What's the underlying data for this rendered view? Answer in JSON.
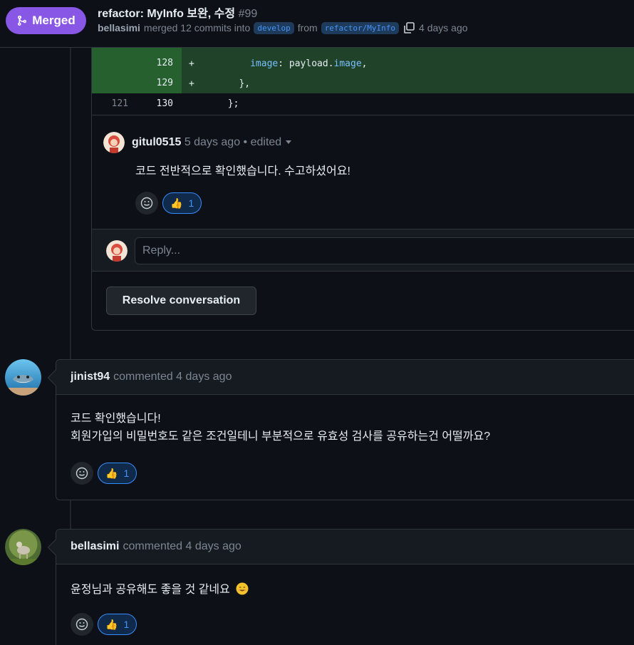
{
  "header": {
    "status": "Merged",
    "title": "refactor: MyInfo 보완, 수정",
    "number": "#99",
    "author": "bellasimi",
    "merge_text": "merged 12 commits into",
    "base_branch": "develop",
    "from_text": "from",
    "head_branch": "refactor/MyInfo",
    "time": "4 days ago"
  },
  "diff": {
    "rows": [
      {
        "old": "",
        "new": "128",
        "sign": "+",
        "indent": "          ",
        "key": "image",
        "rest": ": payload.",
        "key2": "image",
        "tail": ","
      },
      {
        "old": "",
        "new": "129",
        "sign": "+",
        "code": "        },"
      },
      {
        "old": "121",
        "new": "130",
        "sign": "",
        "code": "      };"
      }
    ]
  },
  "review_comment": {
    "author": "gitul0515",
    "time": "5 days ago",
    "edited": "• edited",
    "body": "코드 전반적으로 확인했습니다. 수고하셨어요!",
    "reaction_count": "1",
    "reply_placeholder": "Reply...",
    "resolve_label": "Resolve conversation"
  },
  "comments": [
    {
      "author": "jinist94",
      "action": "commented 4 days ago",
      "body_line1": "코드 확인했습니다!",
      "body_line2": "회원가입의 비밀번호도 같은 조건일테니 부분적으로 유효성 검사를 공유하는건 어떨까요?",
      "reaction_count": "1"
    },
    {
      "author": "bellasimi",
      "action": "commented 4 days ago",
      "body_line1": "윤정님과 공유해도 좋을 것 같네요",
      "reaction_count": "1"
    }
  ],
  "colors": {
    "merged": "#8957e5",
    "addition_bg": "#1f4228",
    "link": "#4493f8"
  }
}
